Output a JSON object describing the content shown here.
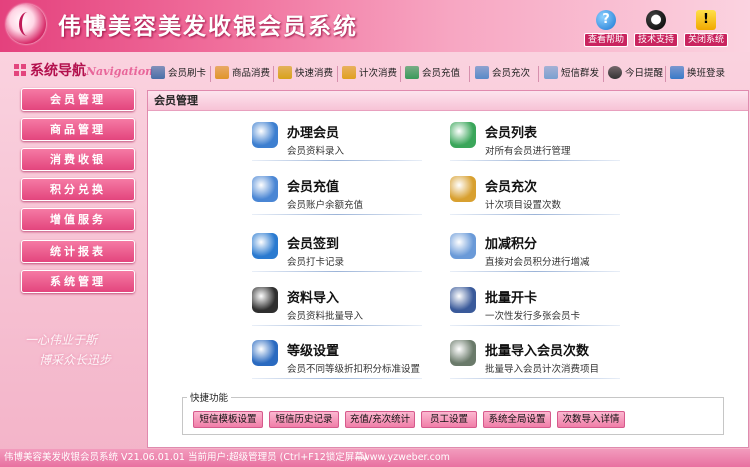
{
  "app": {
    "title": "伟博美容美发收银会员系统"
  },
  "header_buttons": [
    {
      "label": "查看帮助",
      "icon": "help-icon"
    },
    {
      "label": "技术支持",
      "icon": "qq-penguin-icon"
    },
    {
      "label": "关闭系统",
      "icon": "warning-icon"
    }
  ],
  "nav": {
    "title": "系统导航",
    "title_en": "Navigation",
    "items": [
      "会员管理",
      "商品管理",
      "消费收银",
      "积分兑换",
      "增值服务",
      "统计报表",
      "系统管理"
    ]
  },
  "slogan": [
    "一心伟业于斯",
    "博采众长迅步"
  ],
  "toolbar": [
    {
      "label": "会员刷卡",
      "icon": "card-reader-icon",
      "color": "#4a6fa8"
    },
    {
      "label": "商品消费",
      "icon": "shopping-icon",
      "color": "#e0952a"
    },
    {
      "label": "快速消费",
      "icon": "fast-pay-icon",
      "color": "#d8a21c"
    },
    {
      "label": "计次消费",
      "icon": "count-icon",
      "color": "#e0a020"
    },
    {
      "label": "会员充值",
      "icon": "recharge-icon",
      "color": "#3a9a5a"
    },
    {
      "label": "会员充次",
      "icon": "recharge-times-icon",
      "color": "#5a8ac8"
    },
    {
      "label": "短信群发",
      "icon": "sms-icon",
      "color": "#7aa0d0"
    },
    {
      "label": "今日提醒",
      "icon": "clock-icon",
      "color": "#333333"
    },
    {
      "label": "换班登录",
      "icon": "login-icon",
      "color": "#3a7ac8"
    }
  ],
  "main": {
    "title": "会员管理",
    "cards": [
      {
        "title": "办理会员",
        "desc": "会员资料录入",
        "icon": "add-member-icon",
        "color": "#3d7fd0"
      },
      {
        "title": "会员列表",
        "desc": "对所有会员进行管理",
        "icon": "member-list-icon",
        "color": "#3aa65a"
      },
      {
        "title": "会员充值",
        "desc": "会员账户余额充值",
        "icon": "recharge-icon",
        "color": "#4a86d4"
      },
      {
        "title": "会员充次",
        "desc": "计次项目设置次数",
        "icon": "recharge-times-icon",
        "color": "#d8a030"
      },
      {
        "title": "会员签到",
        "desc": "会员打卡记录",
        "icon": "signin-icon",
        "color": "#2a7ad0"
      },
      {
        "title": "加减积分",
        "desc": "直接对会员积分进行增减",
        "icon": "points-icon",
        "color": "#6a9ad8"
      },
      {
        "title": "资料导入",
        "desc": "会员资料批量导入",
        "icon": "laptop-import-icon",
        "color": "#2f2f2f"
      },
      {
        "title": "批量开卡",
        "desc": "一次性发行多张会员卡",
        "icon": "batch-card-icon",
        "color": "#3a5a9a"
      },
      {
        "title": "等级设置",
        "desc": "会员不同等级折扣积分标准设置",
        "icon": "level-user-icon",
        "color": "#2a6ac0"
      },
      {
        "title": "批量导入会员次数",
        "desc": "批量导入会员计次消费项目",
        "icon": "batch-import-icon",
        "color": "#6a7a6a"
      }
    ],
    "quick": {
      "label": "快捷功能",
      "buttons": [
        "短信模板设置",
        "短信历史记录",
        "充值/充次统计",
        "员工设置",
        "系统全局设置",
        "次数导入详情"
      ]
    }
  },
  "status": {
    "left": "伟博美容美发收银会员系统 V21.06.01.01 当前用户:超级管理员 (Ctrl+F12锁定屏幕)",
    "right": "www.yzweber.com"
  }
}
